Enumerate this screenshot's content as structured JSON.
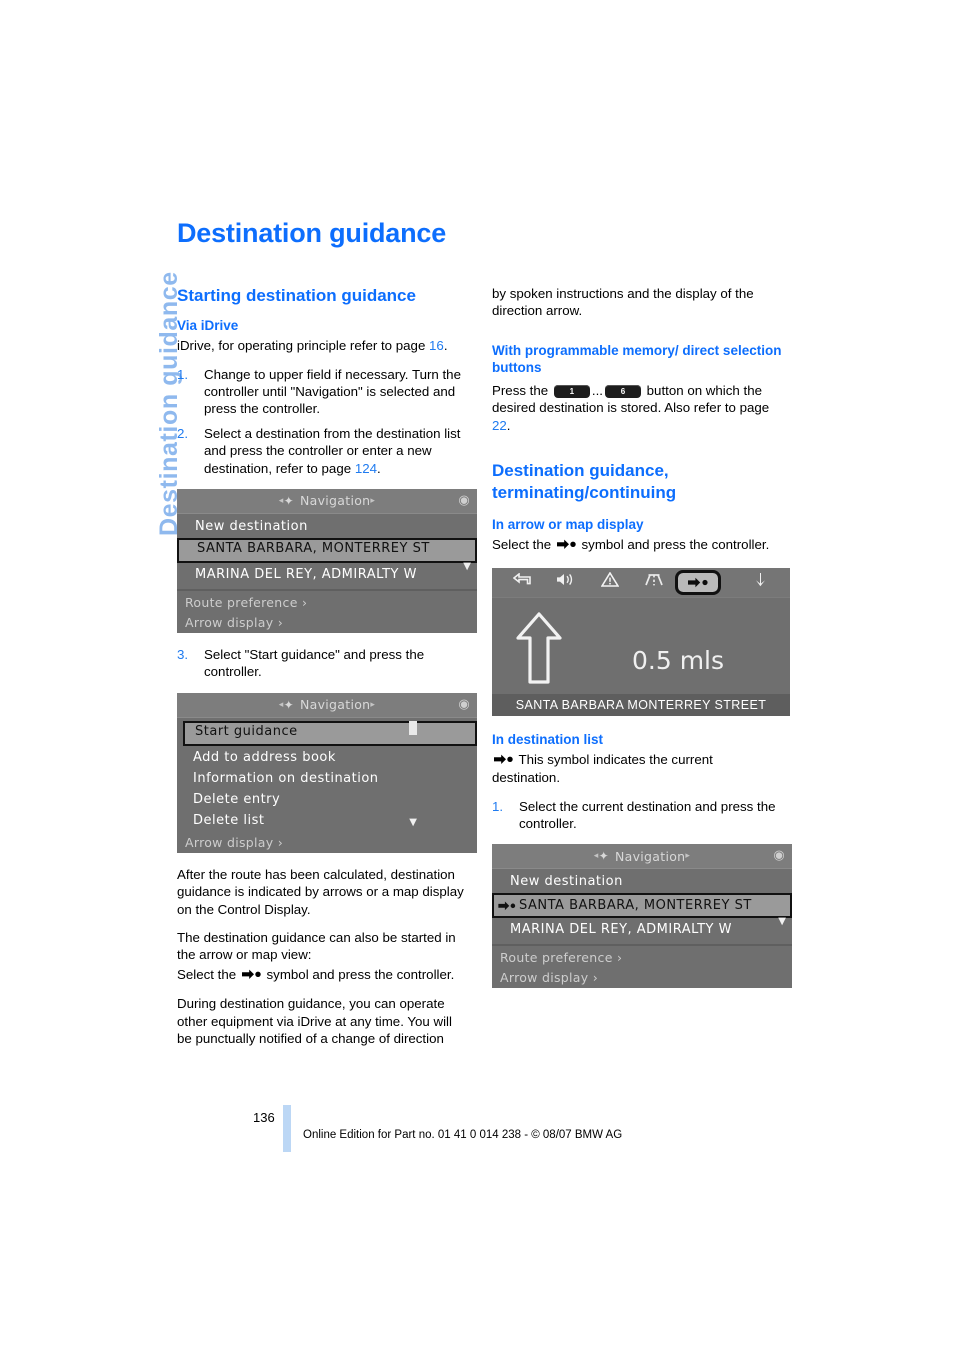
{
  "sidebar": {
    "tab_label": "Destination guidance"
  },
  "page": {
    "title": "Destination guidance",
    "number": "136",
    "footer_note": "Online Edition for Part no. 01 41 0 014 238 - © 08/07 BMW AG"
  },
  "left_column": {
    "h2_starting": "Starting destination guidance",
    "h3_via_idrive": "Via iDrive",
    "intro": "iDrive, for operating principle refer to page ",
    "intro_page": "16",
    "intro_end": ".",
    "steps": [
      {
        "num": "1.",
        "text": "Change to upper field if necessary. Turn the controller until \"Navigation\" is selected and press the controller."
      },
      {
        "num": "2.",
        "text": "Select a destination from the destination list and press the controller or enter a new destination, refer to page ",
        "link": "124",
        "tail": "."
      }
    ],
    "step3_num": "3.",
    "step3_text": "Select \"Start guidance\" and press the controller.",
    "para_after_route": "After the route has been calculated, destination guidance is indicated by arrows or a map display on the Control Display.",
    "para_also_started": "The destination guidance can also be started in the arrow or map view:",
    "para_select_pre": "Select the ",
    "para_select_post": " symbol and press the controller.",
    "para_during_1": "During destination guidance, you can operate other equipment via iDrive at any time. You will be punctually notified of a change of direction"
  },
  "right_column": {
    "para_continued": "by spoken instructions and the display of the direction arrow.",
    "h3_memory": "With programmable memory/ direct selection buttons",
    "memory_pre": "Press the ",
    "memory_btn_1": "1",
    "memory_ellipsis": "...",
    "memory_btn_6": "6",
    "memory_post": " button on which the desired destination is stored. Also refer to page ",
    "memory_page": "22",
    "memory_end": ".",
    "h2_terminating": "Destination guidance, terminating/continuing",
    "h3_arrow_map": "In arrow or map display",
    "arrow_map_pre": "Select the ",
    "arrow_map_post": " symbol and press the controller.",
    "h3_dest_list": "In destination list",
    "dest_list_text": " This symbol indicates the current destination.",
    "dest_step_num": "1.",
    "dest_step_text": "Select the current destination and press the controller."
  },
  "screens": {
    "nav_menu_1": {
      "header": "Navigation",
      "rows": [
        {
          "label": "New destination",
          "selected": false,
          "marker": false
        },
        {
          "label": "SANTA BARBARA, MONTERREY ST",
          "selected": true,
          "marker": false
        },
        {
          "label": "MARINA DEL REY, ADMIRALTY W",
          "selected": false,
          "marker": false
        }
      ],
      "footer_rows": [
        "Route preference ›",
        "Arrow display ›"
      ]
    },
    "nav_menu_2": {
      "header": "Navigation",
      "rows": [
        {
          "label": "Start guidance",
          "selected": true
        },
        {
          "label": "Add to address book",
          "selected": false
        },
        {
          "label": "Information on destination",
          "selected": false
        },
        {
          "label": "Delete entry",
          "selected": false
        },
        {
          "label": "Delete list",
          "selected": false
        }
      ],
      "footer_rows": [
        "Arrow display ›"
      ]
    },
    "arrow_display": {
      "distance": "0.5 mls",
      "street": "SANTA BARBARA MONTERREY STREET",
      "toolbar_icons": [
        "back-icon",
        "speaker-icon",
        "warning-icon",
        "highway-icon",
        "destination-arrow-icon",
        "down-arrow-icon"
      ]
    },
    "nav_menu_3": {
      "header": "Navigation",
      "rows": [
        {
          "label": "New destination",
          "selected": false,
          "marker": false
        },
        {
          "label": "SANTA BARBARA, MONTERREY ST",
          "selected": true,
          "marker": true
        },
        {
          "label": "MARINA DEL REY, ADMIRALTY W",
          "selected": false,
          "marker": false
        }
      ],
      "footer_rows": [
        "Route preference ›",
        "Arrow display ›"
      ]
    }
  },
  "colors": {
    "heading_blue": "#0d6efd",
    "sidetab_blue": "#8fb9ee",
    "footer_bar": "#bcd7f5"
  }
}
